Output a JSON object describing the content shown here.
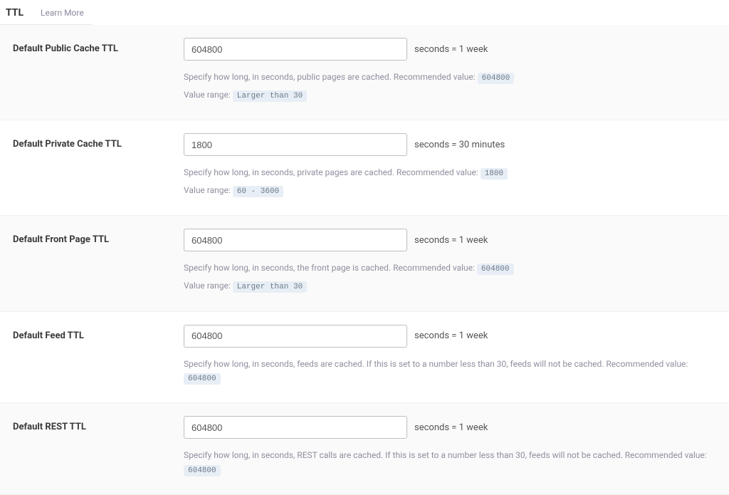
{
  "header": {
    "title": "TTL",
    "learn_more": "Learn More"
  },
  "rows": {
    "public": {
      "label": "Default Public Cache TTL",
      "value": "604800",
      "suffix": "seconds = 1 week",
      "help_prefix": "Specify how long, in seconds, public pages are cached. Recommended value:",
      "rec_value": "604800",
      "range_label": "Value range:",
      "range_value": "Larger than 30"
    },
    "private": {
      "label": "Default Private Cache TTL",
      "value": "1800",
      "suffix": "seconds = 30 minutes",
      "help_prefix": "Specify how long, in seconds, private pages are cached. Recommended value:",
      "rec_value": "1800",
      "range_label": "Value range:",
      "range_value": "60 - 3600"
    },
    "front": {
      "label": "Default Front Page TTL",
      "value": "604800",
      "suffix": "seconds = 1 week",
      "help_prefix": "Specify how long, in seconds, the front page is cached. Recommended value:",
      "rec_value": "604800",
      "range_label": "Value range:",
      "range_value": "Larger than 30"
    },
    "feed": {
      "label": "Default Feed TTL",
      "value": "604800",
      "suffix": "seconds = 1 week",
      "help_prefix": "Specify how long, in seconds, feeds are cached. If this is set to a number less than 30, feeds will not be cached. Recommended value:",
      "rec_value": "604800"
    },
    "rest": {
      "label": "Default REST TTL",
      "value": "604800",
      "suffix": "seconds = 1 week",
      "help_prefix": "Specify how long, in seconds, REST calls are cached. If this is set to a number less than 30, feeds will not be cached. Recommended value:",
      "rec_value": "604800"
    }
  }
}
